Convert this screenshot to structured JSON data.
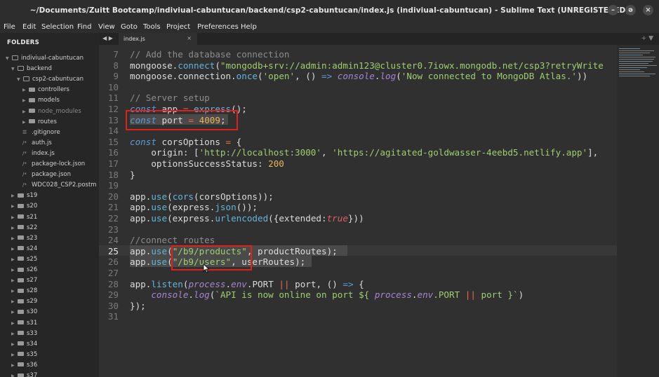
{
  "window": {
    "title": "~/Documents/Zuitt Bootcamp/indiviual-cabuntucan/backend/csp2-cabuntucan/index.js (indiviual-cabuntucan) - Sublime Text (UNREGISTERED)",
    "btn_min": "–",
    "btn_max": "ə",
    "btn_close": "×"
  },
  "menu": [
    "File",
    "Edit",
    "Selection",
    "Find",
    "View",
    "Goto",
    "Tools",
    "Project",
    "Preferences",
    "Help"
  ],
  "sidebar": {
    "header": "FOLDERS",
    "tree": [
      {
        "label": "indiviual-cabuntucan",
        "type": "folder-open"
      },
      {
        "label": "backend",
        "type": "folder-open"
      },
      {
        "label": "csp2-cabuntucan",
        "type": "folder-open"
      },
      {
        "label": "controllers",
        "type": "folder"
      },
      {
        "label": "models",
        "type": "folder"
      },
      {
        "label": "node_modules",
        "type": "folder"
      },
      {
        "label": "routes",
        "type": "folder"
      },
      {
        "label": ".gitignore",
        "type": "file-lines"
      },
      {
        "label": "auth.js",
        "type": "file-code"
      },
      {
        "label": "index.js",
        "type": "file-code"
      },
      {
        "label": "package-lock.json",
        "type": "file-code"
      },
      {
        "label": "package.json",
        "type": "file-code"
      },
      {
        "label": "WDC028_CSP2.postm",
        "type": "file-code"
      },
      {
        "label": "s19",
        "type": "folder"
      },
      {
        "label": "s20",
        "type": "folder"
      },
      {
        "label": "s21",
        "type": "folder"
      },
      {
        "label": "s22",
        "type": "folder"
      },
      {
        "label": "s23",
        "type": "folder"
      },
      {
        "label": "s24",
        "type": "folder"
      },
      {
        "label": "s25",
        "type": "folder"
      },
      {
        "label": "s26",
        "type": "folder"
      },
      {
        "label": "s27",
        "type": "folder"
      },
      {
        "label": "s28",
        "type": "folder"
      },
      {
        "label": "s29",
        "type": "folder"
      },
      {
        "label": "s30",
        "type": "folder"
      },
      {
        "label": "s31",
        "type": "folder"
      },
      {
        "label": "s33",
        "type": "folder"
      },
      {
        "label": "s34",
        "type": "folder"
      },
      {
        "label": "s35",
        "type": "folder"
      },
      {
        "label": "s36",
        "type": "folder"
      },
      {
        "label": "s37",
        "type": "folder"
      }
    ],
    "file_icon": "/*",
    "lines_icon": "☰"
  },
  "tabs": {
    "nav": "◀ ▶",
    "active": "index.js",
    "close": "×",
    "plus": "+ ▼"
  },
  "editor": {
    "current_line": 25,
    "lines": [
      {
        "n": "7",
        "t": [
          [
            "c",
            "// Add the database connection"
          ]
        ]
      },
      {
        "n": "8",
        "t": [
          [
            "",
            "mongoose."
          ],
          [
            "f",
            "connect"
          ],
          [
            "",
            "("
          ],
          [
            "s",
            "\"mongodb+srv://admin:admin123@cluster0.7iowx.mongodb.net/csp3?retryWrite"
          ]
        ]
      },
      {
        "n": "9",
        "t": [
          [
            "",
            "mongoose.connection."
          ],
          [
            "f",
            "once"
          ],
          [
            "",
            "("
          ],
          [
            "s",
            "'open'"
          ],
          [
            "",
            ", () "
          ],
          [
            "k",
            "=>"
          ],
          [
            "",
            " "
          ],
          [
            "p",
            "console"
          ],
          [
            "",
            "."
          ],
          [
            "p",
            "log"
          ],
          [
            "",
            "("
          ],
          [
            "s",
            "'Now connected to MongoDB Atlas.'"
          ],
          [
            "",
            "))"
          ]
        ]
      },
      {
        "n": "10",
        "t": []
      },
      {
        "n": "11",
        "t": [
          [
            "c",
            "// Server setup"
          ]
        ]
      },
      {
        "n": "12",
        "t": [
          [
            "k",
            "const"
          ],
          [
            "",
            " app "
          ],
          [
            "o",
            "="
          ],
          [
            "",
            " "
          ],
          [
            "f",
            "express"
          ],
          [
            "",
            "();"
          ]
        ]
      },
      {
        "n": "13",
        "t": [
          [
            "k",
            "const"
          ],
          [
            "",
            " port "
          ],
          [
            "o",
            "="
          ],
          [
            "",
            " "
          ],
          [
            "n",
            "4009"
          ],
          [
            "",
            ";"
          ]
        ]
      },
      {
        "n": "14",
        "t": []
      },
      {
        "n": "15",
        "t": [
          [
            "k",
            "const"
          ],
          [
            "",
            " corsOptions "
          ],
          [
            "o",
            "="
          ],
          [
            "",
            " {"
          ]
        ]
      },
      {
        "n": "16",
        "t": [
          [
            "",
            "    origin: ["
          ],
          [
            "s",
            "'http://localhost:3000'"
          ],
          [
            "",
            ", "
          ],
          [
            "s",
            "'https://agitated-goldwasser-4eebd5.netlify.app'"
          ],
          [
            "",
            "],"
          ]
        ]
      },
      {
        "n": "17",
        "t": [
          [
            "",
            "    optionsSuccessStatus: "
          ],
          [
            "n",
            "200"
          ]
        ]
      },
      {
        "n": "18",
        "t": [
          [
            "",
            "}"
          ]
        ]
      },
      {
        "n": "19",
        "t": []
      },
      {
        "n": "20",
        "t": [
          [
            "",
            "app."
          ],
          [
            "f",
            "use"
          ],
          [
            "",
            "("
          ],
          [
            "f",
            "cors"
          ],
          [
            "",
            "(corsOptions));"
          ]
        ]
      },
      {
        "n": "21",
        "t": [
          [
            "",
            "app."
          ],
          [
            "f",
            "use"
          ],
          [
            "",
            "(express."
          ],
          [
            "f",
            "json"
          ],
          [
            "",
            "());"
          ]
        ]
      },
      {
        "n": "22",
        "t": [
          [
            "",
            "app."
          ],
          [
            "f",
            "use"
          ],
          [
            "",
            "(express."
          ],
          [
            "f",
            "urlencoded"
          ],
          [
            "",
            "({extended:"
          ],
          [
            "b",
            "true"
          ],
          [
            "",
            "}))"
          ]
        ]
      },
      {
        "n": "23",
        "t": []
      },
      {
        "n": "24",
        "t": [
          [
            "c",
            "//connect routes"
          ]
        ]
      },
      {
        "n": "25",
        "t": [
          [
            "",
            "app."
          ],
          [
            "f",
            "use"
          ],
          [
            "",
            "("
          ],
          [
            "s",
            "\"/b9/products\""
          ],
          [
            "",
            ", productRoutes);"
          ]
        ]
      },
      {
        "n": "26",
        "t": [
          [
            "",
            "app."
          ],
          [
            "f",
            "use"
          ],
          [
            "",
            "("
          ],
          [
            "s",
            "\"/b9/users\""
          ],
          [
            "",
            ", userRoutes);"
          ]
        ]
      },
      {
        "n": "27",
        "t": []
      },
      {
        "n": "28",
        "t": [
          [
            "",
            "app."
          ],
          [
            "f",
            "listen"
          ],
          [
            "",
            "("
          ],
          [
            "p",
            "process"
          ],
          [
            "",
            "."
          ],
          [
            "p",
            "env"
          ],
          [
            "",
            ".PORT "
          ],
          [
            "o",
            "||"
          ],
          [
            "",
            " port, () "
          ],
          [
            "k",
            "=>"
          ],
          [
            "",
            " {"
          ]
        ]
      },
      {
        "n": "29",
        "t": [
          [
            "",
            "    "
          ],
          [
            "p",
            "console"
          ],
          [
            "",
            "."
          ],
          [
            "p",
            "log"
          ],
          [
            "",
            "("
          ],
          [
            "s",
            "`API is now online on port ${ "
          ],
          [
            "p",
            "process"
          ],
          [
            "",
            "."
          ],
          [
            "p",
            "env"
          ],
          [
            "s",
            ".PORT "
          ],
          [
            "o",
            "||"
          ],
          [
            "s",
            " port }`"
          ],
          [
            "",
            ")"
          ]
        ]
      },
      {
        "n": "30",
        "t": [
          [
            "",
            "});"
          ]
        ]
      },
      {
        "n": "31",
        "t": []
      }
    ]
  },
  "colors": {
    "annotation_box": "#e0201b",
    "string": "#9fce6e",
    "number": "#e8b35a",
    "keyword": "#5b9bd5",
    "comment": "#8c8c8c"
  }
}
